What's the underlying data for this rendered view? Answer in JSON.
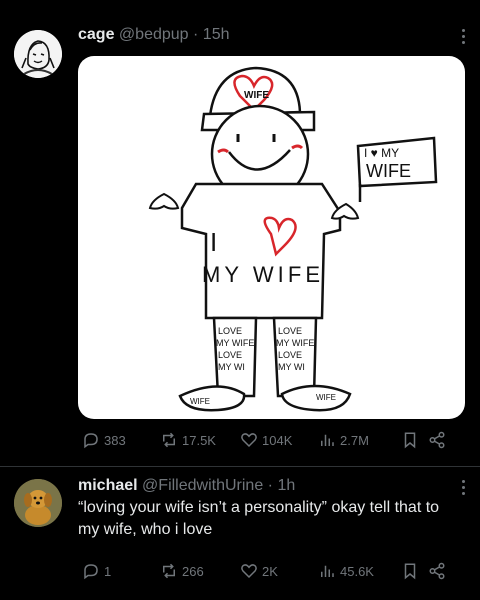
{
  "posts": [
    {
      "display_name": "cage",
      "handle": "@bedpup",
      "separator": "·",
      "time": "15h",
      "avatar_icon": "drawn-avatar",
      "media": {
        "hat_text": "WIFE",
        "shirt_text_1": "I",
        "shirt_text_2": "MY WIFE",
        "sign_text_1": "I ♥ MY",
        "sign_text_2": "WIFE",
        "pants_text_left": [
          "LOVE",
          "MY WIFE",
          "LOVE",
          "MY WI"
        ],
        "pants_text_right": [
          "LOVE",
          "MY WIFE",
          "LOVE",
          "MY WI"
        ],
        "shoe_text_left": "WIFE",
        "shoe_text_right": "WIFE"
      },
      "stats": {
        "replies": "383",
        "reposts": "17.5K",
        "likes": "104K",
        "views": "2.7M"
      }
    },
    {
      "display_name": "michael",
      "handle": "@FilledwithUrine",
      "separator": "·",
      "time": "1h",
      "avatar_icon": "plush-dog-avatar",
      "text": "“loving your wife isn’t a personality” okay tell that to my wife, who i love",
      "stats": {
        "replies": "1",
        "reposts": "266",
        "likes": "2K",
        "views": "45.6K"
      }
    }
  ],
  "colors": {
    "background": "#000000",
    "text": "#e7e9ea",
    "muted": "#71767b",
    "divider": "#2f3336",
    "heart_red": "#d8262b"
  }
}
